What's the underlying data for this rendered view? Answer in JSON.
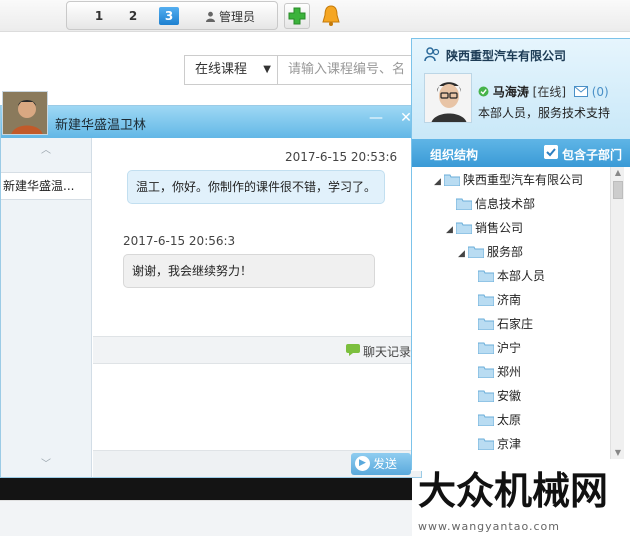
{
  "toolbar": {
    "tabs": [
      "1",
      "2",
      "3"
    ],
    "active_tab_index": 2,
    "admin_label": "管理员",
    "icons": [
      "person-icon",
      "plus-icon",
      "bell-icon"
    ]
  },
  "search": {
    "category": "在线课程",
    "placeholder": "请输入课程编号、名"
  },
  "chat": {
    "title": "新建华盛温卫林",
    "contact_name": "新建华盛温...",
    "messages": [
      {
        "time": "2017-6-15 20:53:6",
        "text": "温工，你好。你制作的课件很不错，学习了。",
        "direction": "out"
      },
      {
        "time": "2017-6-15 20:56:3",
        "text": "谢谢，我会继续努力！",
        "direction": "in"
      }
    ],
    "history_label": "聊天记录",
    "send_label": "发送",
    "colors": {
      "title_bar": "#62b7e6",
      "send_button": "#5aa9dc"
    }
  },
  "org": {
    "company": "陕西重型汽车有限公司",
    "user": {
      "name": "马海涛",
      "status": "[在线]",
      "mail_count": "(0)",
      "role": "本部人员，服务技术支持"
    },
    "section_title": "组织结构",
    "include_sub_label": "包含子部门",
    "include_sub_checked": true,
    "tree": [
      {
        "label": "陕西重型汽车有限公司",
        "level": 0,
        "expanded": true
      },
      {
        "label": "信息技术部",
        "level": 1,
        "expanded": false
      },
      {
        "label": "销售公司",
        "level": 1,
        "expanded": true
      },
      {
        "label": "服务部",
        "level": 2,
        "expanded": true
      },
      {
        "label": "本部人员",
        "level": 3,
        "expanded": false
      },
      {
        "label": "济南",
        "level": 3,
        "expanded": false
      },
      {
        "label": "石家庄",
        "level": 3,
        "expanded": false
      },
      {
        "label": "沪宁",
        "level": 3,
        "expanded": false
      },
      {
        "label": "郑州",
        "level": 3,
        "expanded": false
      },
      {
        "label": "安徽",
        "level": 3,
        "expanded": false
      },
      {
        "label": "太原",
        "level": 3,
        "expanded": false
      },
      {
        "label": "京津",
        "level": 3,
        "expanded": false
      }
    ]
  },
  "watermark": {
    "brand": "大众机械网",
    "url": "www.wangyantao.com"
  }
}
